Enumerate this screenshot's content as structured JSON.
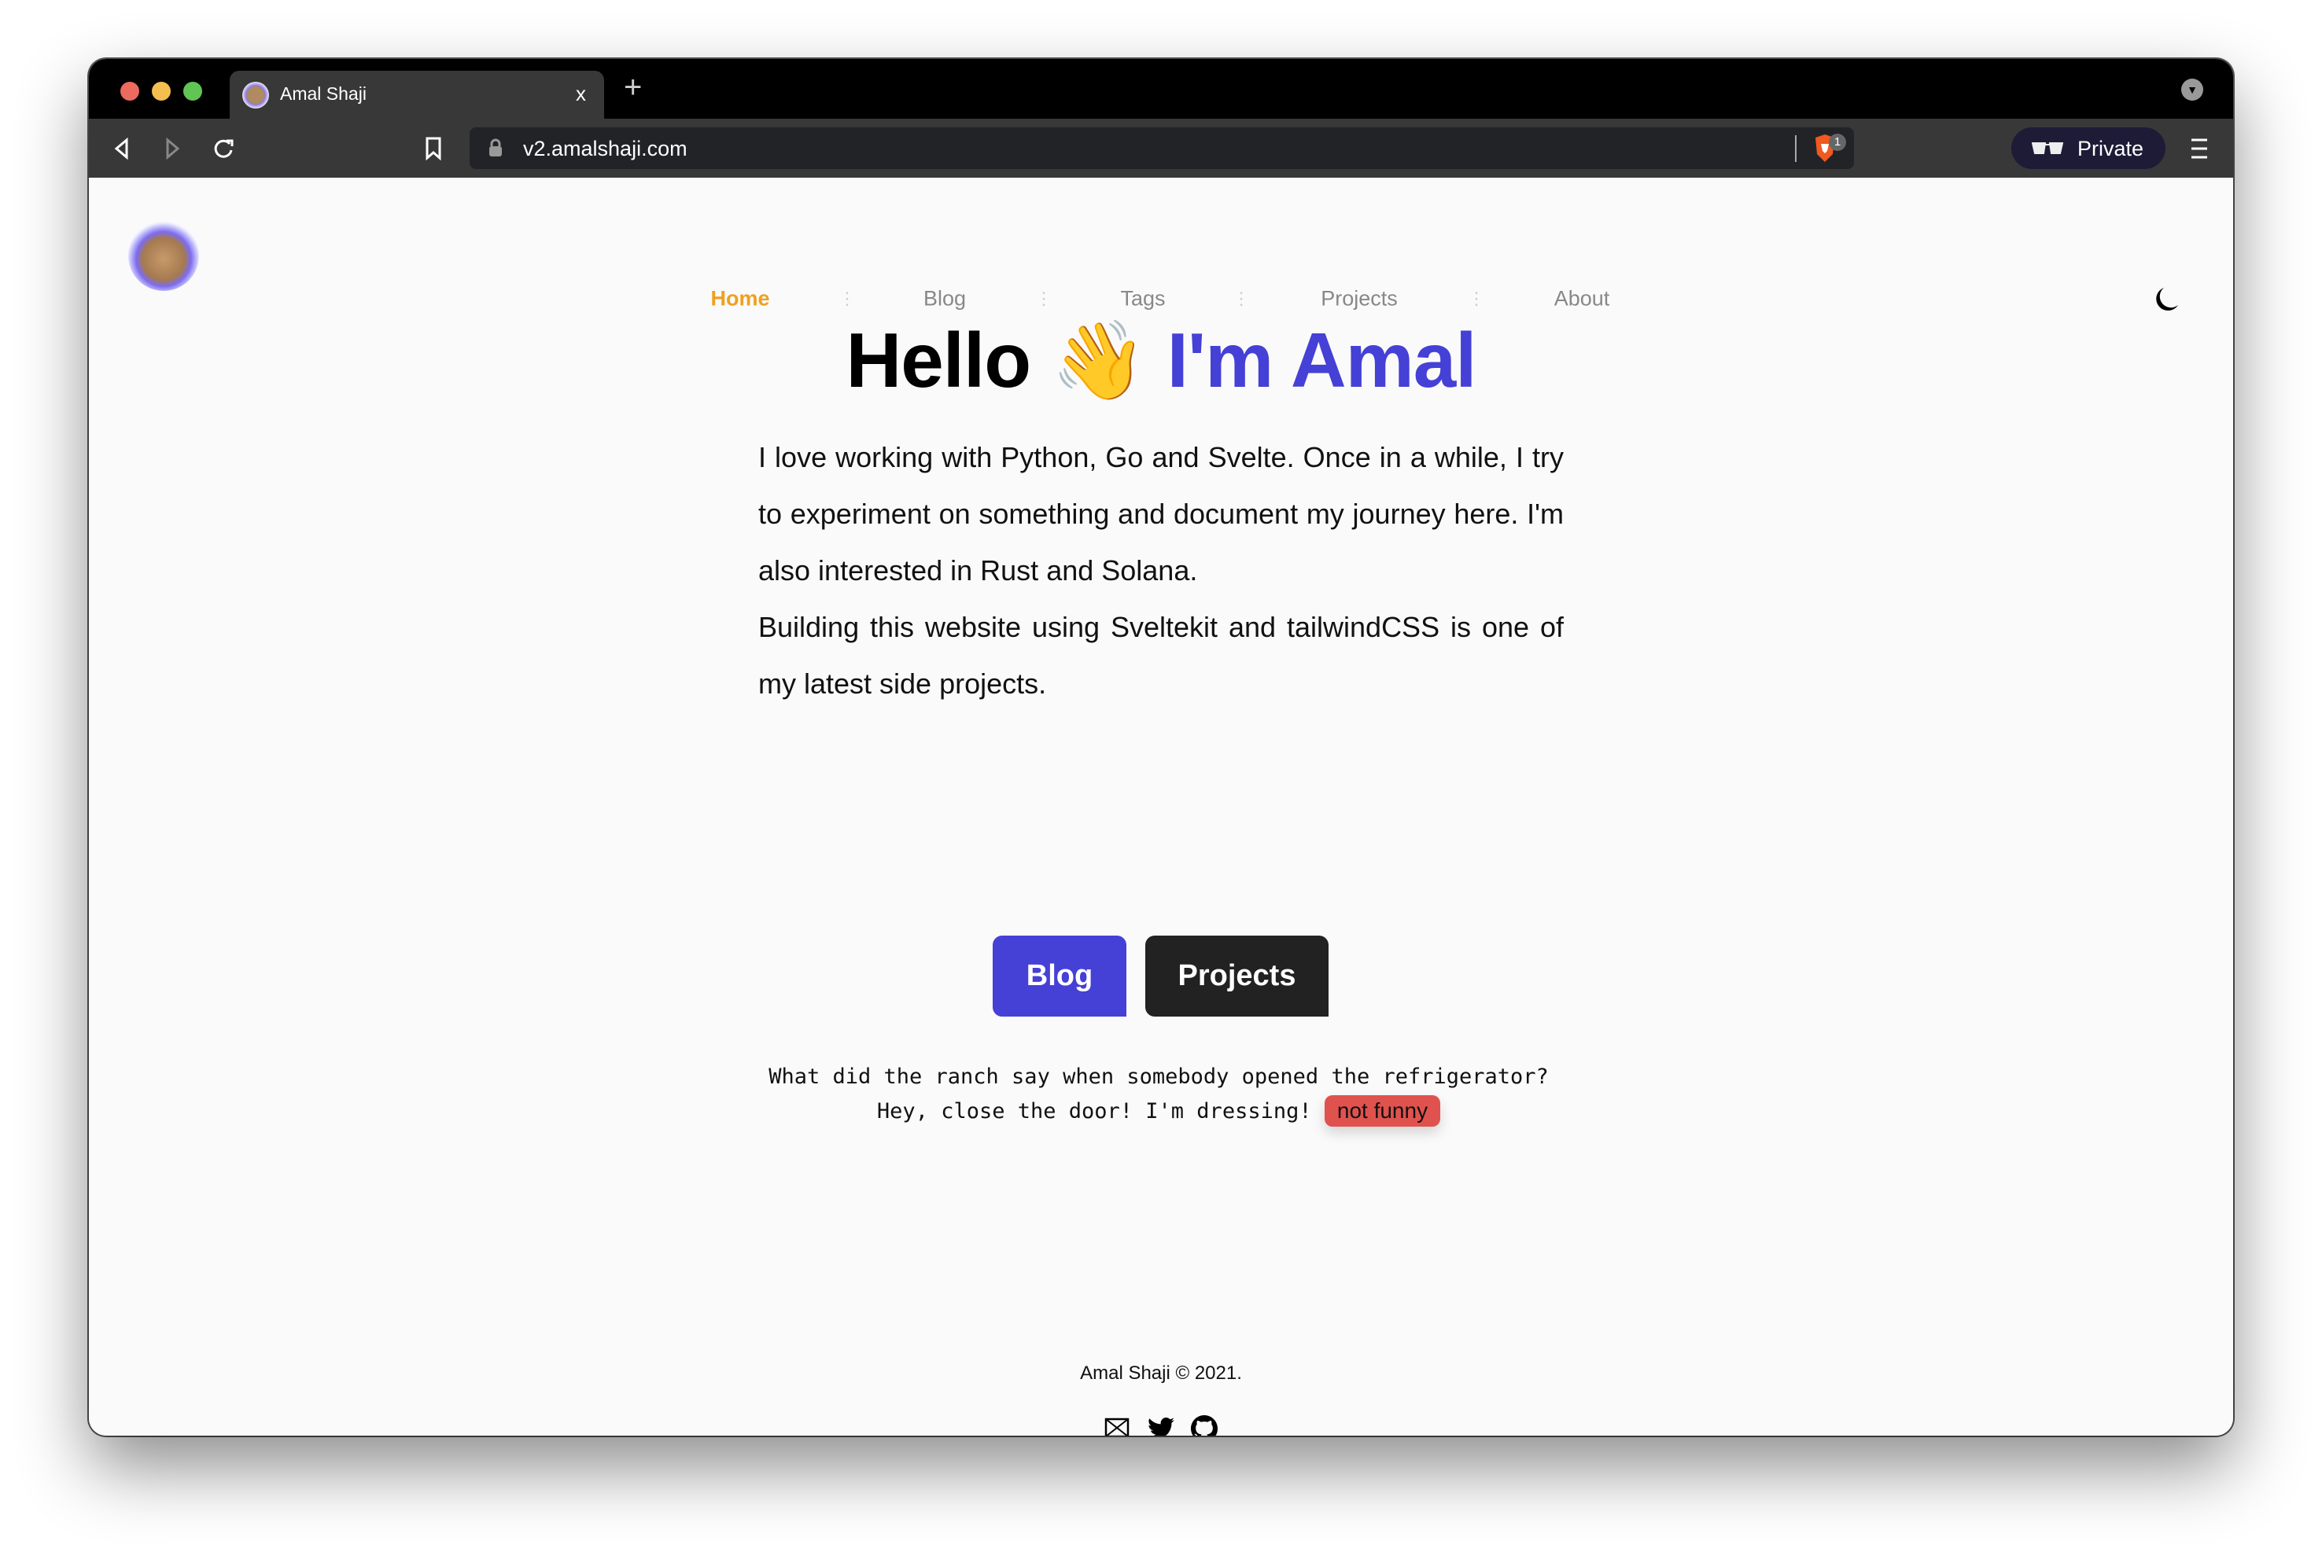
{
  "browser": {
    "tab_title": "Amal Shaji",
    "tab_close": "x",
    "new_tab": "+",
    "url": "v2.amalshaji.com",
    "shield_count": "1",
    "private_label": "Private"
  },
  "nav": {
    "items": [
      {
        "label": "Home",
        "active": true
      },
      {
        "label": "Blog"
      },
      {
        "label": "Tags"
      },
      {
        "label": "Projects"
      },
      {
        "label": "About"
      }
    ],
    "separator": "⋮"
  },
  "hero": {
    "hello": "Hello",
    "wave": "👋",
    "name": "I'm Amal",
    "paragraph1": "I love working with Python, Go and Svelte. Once in a while, I try to experiment on something and document my journey here. I'm also interested in Rust and Solana.",
    "paragraph2": "Building this website using Sveltekit and tailwindCSS is one of my latest side projects."
  },
  "buttons": {
    "blog": "Blog",
    "projects": "Projects"
  },
  "joke": {
    "text": "What did the ranch say when somebody opened the refrigerator? Hey, close the door! I'm dressing!",
    "badge": "not funny"
  },
  "footer": {
    "copyright": "Amal Shaji © 2021."
  },
  "colors": {
    "accent": "#4540d6",
    "active_nav": "#f0a020",
    "badge": "#e0524e",
    "dark_button": "#222222"
  }
}
